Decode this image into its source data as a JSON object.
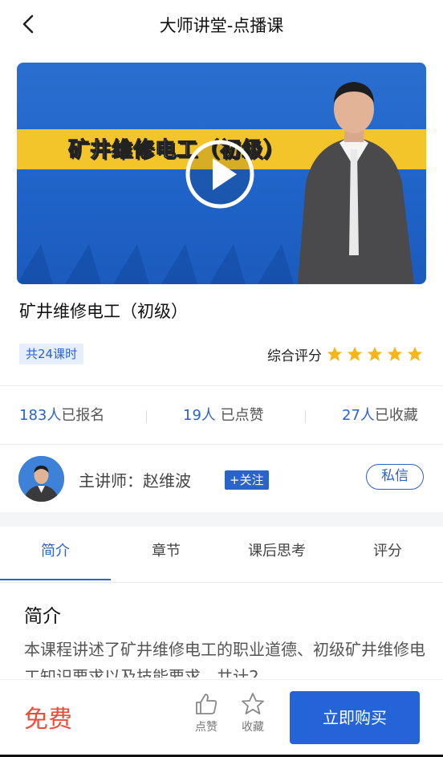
{
  "header": {
    "title": "大师讲堂-点播课"
  },
  "video": {
    "banner_text": "矿井维修电工（初级）"
  },
  "course": {
    "title": "矿井维修电工（初级）",
    "lessons_badge": "共24课时",
    "rating_label": "综合评分",
    "rating_stars": 5
  },
  "stats": [
    {
      "num": "183人",
      "label": "已报名"
    },
    {
      "num": "19人",
      "label": " 已点赞"
    },
    {
      "num": "27人",
      "label": "已收藏"
    }
  ],
  "teacher": {
    "name": "主讲师：赵维波",
    "follow_label": "+关注",
    "message_label": "私信"
  },
  "tabs": [
    "简介",
    "章节",
    "课后思考",
    "评分"
  ],
  "intro": {
    "heading": "简介",
    "body": "本课程讲述了矿井维修电工的职业道德、初级矿井维修电工知识要求以及技能要求，共计2"
  },
  "bottom_bar": {
    "price": "免费",
    "like_label": "点赞",
    "favorite_label": "收藏",
    "buy_label": "立即购买"
  },
  "colors": {
    "accent": "#2a63c9",
    "price": "#f04b3a",
    "star": "#f5b619",
    "banner": "#f4c52a"
  }
}
